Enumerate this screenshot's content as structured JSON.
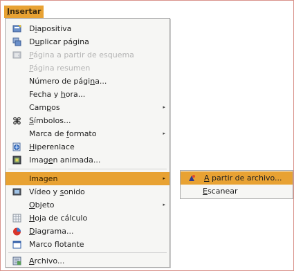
{
  "menubar": {
    "title": "Insertar",
    "accel": "I",
    "rest": "nsertar"
  },
  "menu": {
    "items": [
      {
        "pre": "D",
        "acc": "i",
        "post": "apositiva",
        "icon": "slide-icon"
      },
      {
        "pre": "D",
        "acc": "u",
        "post": "plicar página",
        "icon": "duplicate-slide-icon"
      },
      {
        "pre": "",
        "acc": "P",
        "post": "ágina a partir de esquema",
        "icon": "outline-page-icon",
        "disabled": true
      },
      {
        "pre": "",
        "acc": "P",
        "post": "ágina resumen",
        "disabled": true
      },
      {
        "pre": "Número de pági",
        "acc": "n",
        "post": "a..."
      },
      {
        "pre": "Fecha y ",
        "acc": "h",
        "post": "ora..."
      },
      {
        "pre": "Cam",
        "acc": "p",
        "post": "os",
        "submenu": true
      },
      {
        "pre": "",
        "acc": "S",
        "post": "ímbolos...",
        "icon": "symbols-icon"
      },
      {
        "pre": "Marca de ",
        "acc": "f",
        "post": "ormato",
        "submenu": true
      },
      {
        "pre": "",
        "acc": "H",
        "post": "iperenlace",
        "icon": "hyperlink-icon"
      },
      {
        "pre": "Imag",
        "acc": "e",
        "post": "n animada...",
        "icon": "animated-image-icon"
      },
      {
        "pre": "Imagen",
        "acc": "",
        "post": "",
        "submenu": true,
        "selected": true
      },
      {
        "pre": "Vídeo y ",
        "acc": "s",
        "post": "onido",
        "icon": "video-sound-icon"
      },
      {
        "pre": "",
        "acc": "O",
        "post": "bjeto",
        "submenu": true
      },
      {
        "pre": "",
        "acc": "H",
        "post": "oja de cálculo",
        "icon": "spreadsheet-icon"
      },
      {
        "pre": "",
        "acc": "D",
        "post": "iagrama...",
        "icon": "diagram-icon"
      },
      {
        "pre": "Marco f",
        "acc": "l",
        "post": "otante",
        "icon": "floating-frame-icon"
      },
      {
        "pre": "",
        "acc": "A",
        "post": "rchivo...",
        "icon": "file-icon"
      }
    ]
  },
  "submenu": {
    "items": [
      {
        "pre": "",
        "acc": "A",
        "post": " partir de archivo...",
        "icon": "from-file-icon",
        "selected": true
      },
      {
        "pre": "",
        "acc": "E",
        "post": "scanear"
      }
    ]
  },
  "colors": {
    "highlight": "#e8a233",
    "menu_bg": "#f6f6f4",
    "border": "#a8a8a8"
  }
}
